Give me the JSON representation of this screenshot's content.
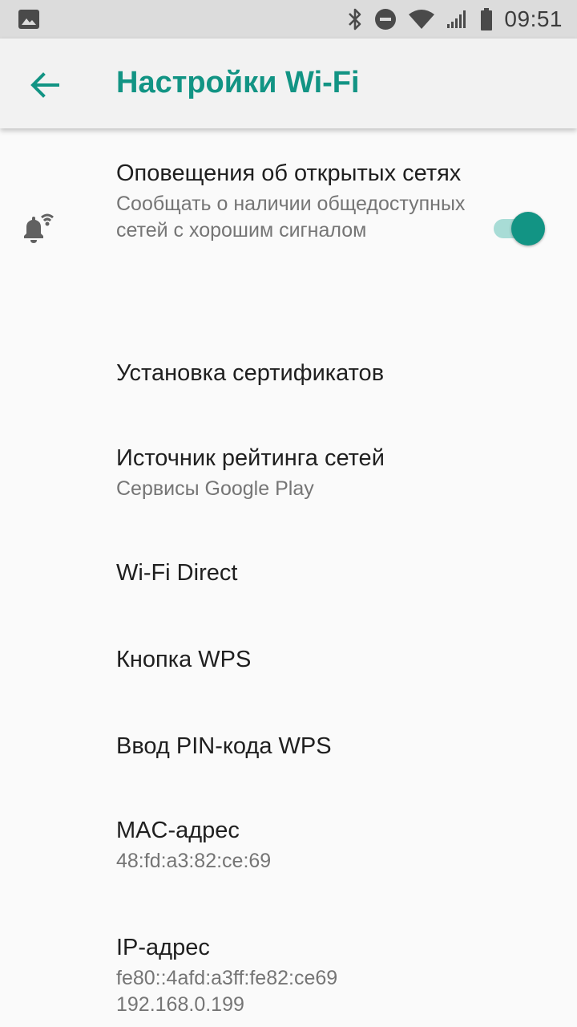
{
  "status_bar": {
    "time": "09:51",
    "icons": [
      "gallery-icon",
      "bluetooth-icon",
      "do-not-disturb-icon",
      "wifi-icon",
      "signal-icon",
      "battery-icon"
    ]
  },
  "app_bar": {
    "back_icon": "arrow-back-icon",
    "title": "Настройки Wi-Fi"
  },
  "colors": {
    "accent": "#129484",
    "toggle_track": "#a8dcd6",
    "status_bar_bg": "#dcdcdc",
    "app_bar_bg": "#f2f2f2",
    "background": "#fafafa",
    "primary_text": "#1f1f1f",
    "secondary_text": "#757575"
  },
  "settings": {
    "open_networks": {
      "icon": "wifi-notification-bell-icon",
      "title": "Оповещения об открытых сетях",
      "summary": "Сообщать о наличии общедоступных сетей с хорошим сигналом",
      "enabled": true
    },
    "install_certs": {
      "title": "Установка сертификатов"
    },
    "network_rating": {
      "title": "Источник рейтинга сетей",
      "summary": "Сервисы Google Play"
    },
    "wifi_direct": {
      "title": "Wi-Fi Direct"
    },
    "wps_button": {
      "title": "Кнопка WPS"
    },
    "wps_pin": {
      "title": "Ввод PIN-кода WPS"
    },
    "mac_address": {
      "title": "MAC-адрес",
      "value": "48:fd:a3:82:ce:69"
    },
    "ip_address": {
      "title": "IP-адрес",
      "value_ipv6": "fe80::4afd:a3ff:fe82:ce69",
      "value_ipv4": "192.168.0.199"
    }
  }
}
